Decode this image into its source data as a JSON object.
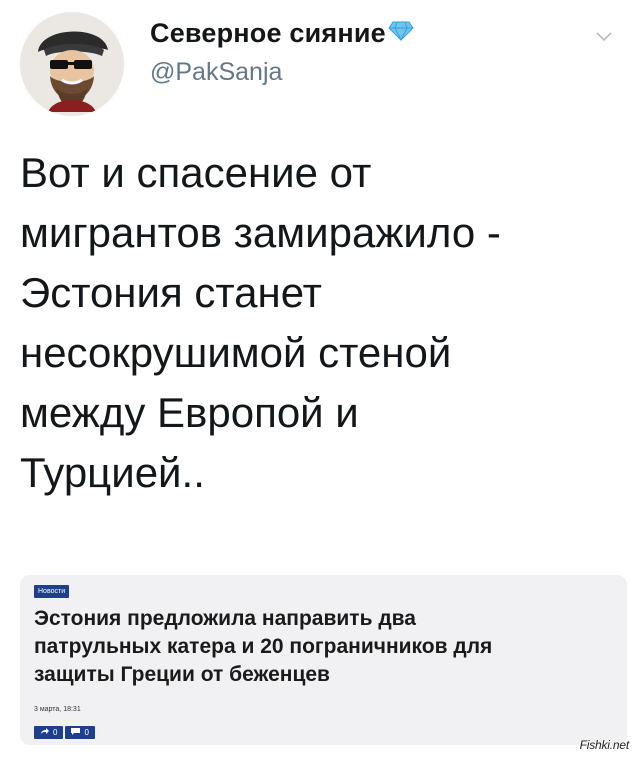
{
  "tweet": {
    "display_name": "Северное сияние",
    "verified_icon": "diamond-icon",
    "handle": "@PakSanja",
    "menu_icon": "chevron-down-icon",
    "text_lines": [
      "Вот и спасение от",
      "мигрантов замиражило -",
      "Эстония станет",
      "несокрушимой стеной",
      "между Европой и",
      "Турцией.."
    ]
  },
  "news_card": {
    "tag": "Новости",
    "headline_lines": [
      "Эстония предложила направить два",
      "патрульных катера и 20 пограничников для",
      "защиты Греции от беженцев"
    ],
    "date": "3 марта, 18:31",
    "actions": [
      {
        "icon": "share-icon",
        "count": "0"
      },
      {
        "icon": "comment-icon",
        "count": "0"
      }
    ],
    "accent_color": "#1f3f8e"
  },
  "watermark": "Fishki.net",
  "colors": {
    "text": "#14171a",
    "secondary_text": "#657786",
    "card_bg": "#f1f1f3"
  }
}
